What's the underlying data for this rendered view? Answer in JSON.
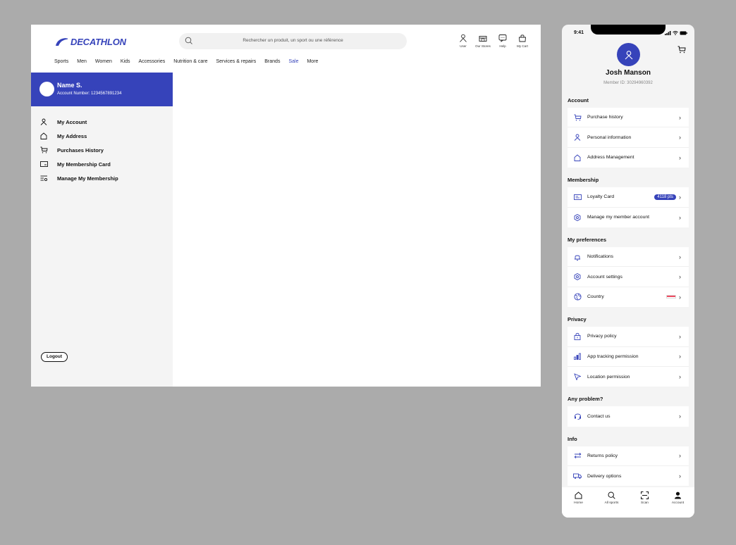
{
  "desktop": {
    "brand": "DECATHLON",
    "search": {
      "placeholder": "Rechercher  un produit, un sport ou une référence"
    },
    "header_icons": [
      {
        "label": "User",
        "icon": "user-icon"
      },
      {
        "label": "Our Stores",
        "icon": "store-icon"
      },
      {
        "label": "Help",
        "icon": "help-icon"
      },
      {
        "label": "My Cart",
        "icon": "cart-icon"
      }
    ],
    "nav": [
      "Sports",
      "Men",
      "Women",
      "Kids",
      "Accessories",
      "Nutrition & care",
      "Services & repairs",
      "Brands",
      "Sale",
      "More"
    ],
    "user": {
      "name": "Name S.",
      "account": "Account Number: 1234567891234"
    },
    "menu": [
      {
        "label": "My Account",
        "icon": "user-icon"
      },
      {
        "label": "My Address",
        "icon": "home-icon"
      },
      {
        "label": "Purchases History",
        "icon": "cart-icon"
      },
      {
        "label": "My Membership Card",
        "icon": "card-icon"
      },
      {
        "label": "Manage My Membership",
        "icon": "settings-list-icon"
      }
    ],
    "logout": "Logout"
  },
  "mobile": {
    "time": "9:41",
    "profile": {
      "name": "Josh Manson",
      "member_id": "Member ID: 30294960392"
    },
    "sections": [
      {
        "title": "Account",
        "rows": [
          {
            "label": "Purchase history",
            "icon": "cart-icon"
          },
          {
            "label": "Personal information",
            "icon": "user-icon"
          },
          {
            "label": "Address Management",
            "icon": "home-icon"
          }
        ]
      },
      {
        "title": "Membership",
        "rows": [
          {
            "label": "Loyalty Card",
            "icon": "card-icon",
            "badge": "4118 pts"
          },
          {
            "label": "Manage my member account",
            "icon": "gear-icon"
          }
        ]
      },
      {
        "title": "My preferences",
        "rows": [
          {
            "label": "Notifications",
            "icon": "bell-icon"
          },
          {
            "label": "Account settings",
            "icon": "gear-icon"
          },
          {
            "label": "Country",
            "icon": "globe-icon",
            "flag": true
          }
        ]
      },
      {
        "title": "Privacy",
        "rows": [
          {
            "label": "Privacy policy",
            "icon": "lock-icon"
          },
          {
            "label": "App tracking permission",
            "icon": "bar-chart-icon"
          },
          {
            "label": "Location permission",
            "icon": "location-arrow-icon"
          }
        ]
      },
      {
        "title": "Any problem?",
        "rows": [
          {
            "label": "Contact us",
            "icon": "headset-icon"
          }
        ]
      },
      {
        "title": "Info",
        "rows": [
          {
            "label": "Returns policy",
            "icon": "return-icon"
          },
          {
            "label": "Delivery options",
            "icon": "truck-icon"
          }
        ]
      }
    ],
    "tabs": [
      {
        "label": "Home",
        "icon": "home-icon"
      },
      {
        "label": "All sports",
        "icon": "search-icon"
      },
      {
        "label": "Scan",
        "icon": "scan-icon"
      },
      {
        "label": "Account",
        "icon": "user-filled-icon"
      }
    ],
    "colors": {
      "brand": "#3643ba",
      "background": "#f4f4f4"
    }
  }
}
